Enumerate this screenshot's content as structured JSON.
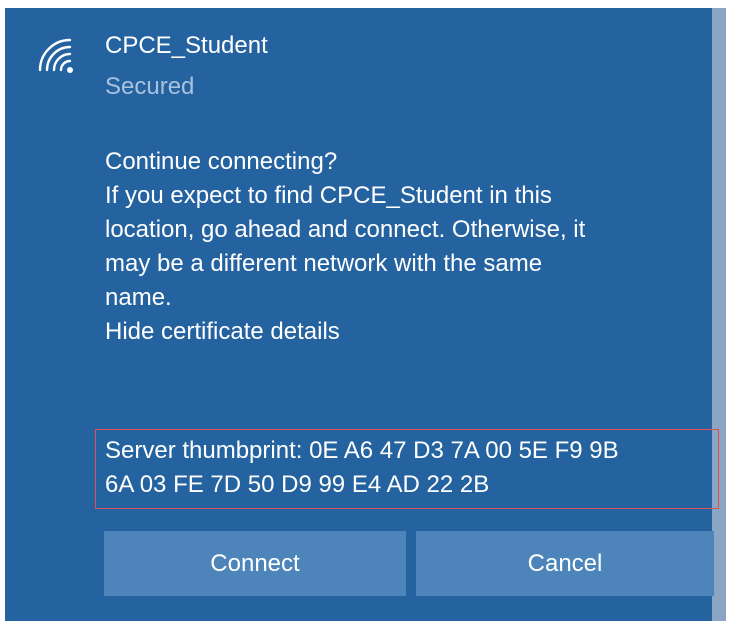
{
  "network": {
    "name": "CPCE_Student",
    "status": "Secured",
    "icon": "wifi-icon"
  },
  "prompt": {
    "heading": "Continue connecting?",
    "message_lines": [
      "If you expect to find CPCE_Student in this",
      "location, go ahead and connect. Otherwise, it",
      "may be a different network with the same",
      "name."
    ],
    "toggle_link": "Hide certificate details"
  },
  "certificate": {
    "thumbprint_lines": [
      "Server thumbprint: 0E A6 47 D3 7A 00 5E F9 9B",
      "6A 03 FE 7D 50 D9 99 E4 AD 22 2B"
    ]
  },
  "buttons": {
    "connect": "Connect",
    "cancel": "Cancel"
  },
  "colors": {
    "panel_background": "#2563a0",
    "button_background": "#4d85ba",
    "secondary_text": "#a8c2de",
    "highlight_border": "#e05050"
  }
}
